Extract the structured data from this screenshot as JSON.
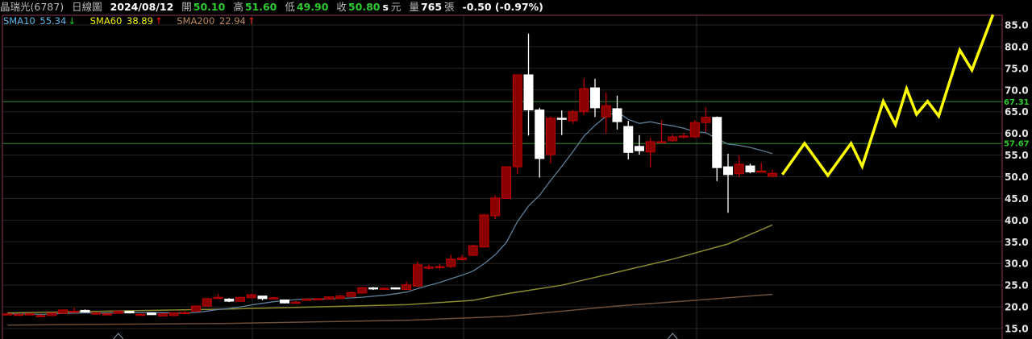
{
  "header": {
    "stock_name": "晶瑞光(6787)",
    "chart_type": "日線圖",
    "date": "2024/08/12",
    "open_label": "開",
    "open": "50.10",
    "high_label": "高",
    "high": "51.60",
    "low_label": "低",
    "low": "49.90",
    "close_label": "收",
    "close": "50.80",
    "unit_s": "s",
    "unit_label": "元",
    "volume_label": "量",
    "volume": "765",
    "volume_unit": "張",
    "change": "-0.50 (-0.97%)"
  },
  "legend": [
    {
      "name": "SMA10",
      "value": "55.34",
      "arrow": "↓",
      "color": "#5fb8e8",
      "arrow_color": "#19d219"
    },
    {
      "name": "SMA60",
      "value": "38.89",
      "arrow": "↑",
      "color": "#f2f200",
      "arrow_color": "#ff2020"
    },
    {
      "name": "SMA200",
      "value": "22.94",
      "arrow": "↑",
      "color": "#b8865a",
      "arrow_color": "#ff2020"
    }
  ],
  "chart_data": {
    "type": "candlestick",
    "ylim": [
      13.5,
      88
    ],
    "y_ticks": [
      "15.0",
      "20.0",
      "25.0",
      "30.0",
      "35.0",
      "40.0",
      "45.0",
      "50.0",
      "55.0",
      "60.0",
      "65.0",
      "70.0",
      "75.0",
      "80.0",
      "85.0"
    ],
    "reference_lines": [
      {
        "value": 67.31,
        "label": "67.31",
        "color": "#2e8b2e"
      },
      {
        "value": 57.67,
        "label": "57.67",
        "color": "#2e8b2e"
      }
    ],
    "colors": {
      "up": "#8b0000",
      "up_border": "#c00000",
      "down": "#ffffff",
      "sma10": "#5f7f96",
      "sma60": "#8a8a30",
      "sma200": "#6b4f3a",
      "forecast": "#ffff00"
    },
    "ohlc": [
      [
        18.4,
        18.6,
        18.2,
        18.4
      ],
      [
        18.3,
        18.5,
        18.1,
        18.3
      ],
      [
        18.4,
        18.6,
        18.2,
        18.4
      ],
      [
        18.0,
        18.3,
        17.8,
        18.0
      ],
      [
        18.0,
        18.7,
        17.9,
        18.6
      ],
      [
        18.5,
        19.4,
        18.4,
        19.3
      ],
      [
        19.0,
        19.8,
        18.8,
        19.0
      ],
      [
        19.2,
        19.4,
        18.7,
        18.8
      ],
      [
        18.6,
        18.8,
        18.4,
        18.6
      ],
      [
        18.4,
        18.6,
        18.2,
        18.4
      ],
      [
        18.5,
        19.2,
        18.4,
        19.0
      ],
      [
        19.0,
        19.1,
        18.5,
        18.6
      ],
      [
        18.3,
        18.5,
        18.1,
        18.3
      ],
      [
        18.6,
        18.7,
        18.1,
        18.2
      ],
      [
        17.9,
        18.5,
        17.8,
        18.4
      ],
      [
        18.0,
        18.7,
        17.9,
        18.6
      ],
      [
        18.7,
        19.0,
        18.5,
        18.7
      ],
      [
        19.0,
        20.3,
        18.9,
        20.2
      ],
      [
        20.2,
        22.0,
        20.1,
        21.9
      ],
      [
        22.2,
        23.0,
        21.9,
        22.2
      ],
      [
        21.8,
        22.0,
        21.1,
        21.3
      ],
      [
        21.3,
        22.3,
        21.2,
        22.2
      ],
      [
        22.1,
        23.0,
        22.0,
        22.8
      ],
      [
        22.5,
        22.6,
        21.5,
        21.9
      ],
      [
        22.1,
        22.3,
        21.9,
        22.1
      ],
      [
        21.6,
        21.7,
        20.8,
        20.9
      ],
      [
        21.1,
        21.3,
        20.8,
        21.1
      ],
      [
        21.5,
        21.9,
        21.4,
        21.8
      ],
      [
        21.6,
        22.0,
        21.5,
        21.9
      ],
      [
        21.8,
        22.4,
        21.7,
        22.3
      ],
      [
        21.9,
        22.8,
        21.8,
        22.5
      ],
      [
        22.4,
        23.6,
        22.3,
        23.3
      ],
      [
        23.2,
        24.6,
        23.0,
        24.4
      ],
      [
        24.4,
        24.6,
        23.9,
        24.3
      ],
      [
        24.2,
        24.5,
        23.9,
        24.3
      ],
      [
        24.4,
        24.5,
        24.0,
        24.3
      ],
      [
        24.0,
        25.8,
        23.9,
        25.1
      ],
      [
        24.8,
        30.4,
        24.6,
        29.7
      ],
      [
        29.2,
        29.8,
        28.6,
        29.2
      ],
      [
        29.2,
        29.9,
        28.7,
        29.3
      ],
      [
        29.3,
        32.0,
        29.0,
        31.0
      ],
      [
        30.9,
        32.0,
        30.6,
        31.3
      ],
      [
        31.9,
        34.4,
        31.7,
        34.1
      ],
      [
        33.8,
        41.4,
        33.7,
        41.2
      ],
      [
        41.0,
        45.7,
        40.3,
        45.1
      ],
      [
        45.0,
        52.3,
        44.9,
        52.3
      ],
      [
        52.3,
        73.5,
        50.6,
        73.5
      ],
      [
        73.5,
        83.0,
        59.5,
        65.4
      ],
      [
        65.4,
        65.9,
        49.8,
        54.2
      ],
      [
        55.1,
        63.9,
        53.0,
        63.5
      ],
      [
        63.5,
        65.3,
        59.6,
        63.3
      ],
      [
        62.9,
        65.4,
        62.2,
        65.0
      ],
      [
        65.0,
        72.7,
        64.2,
        70.3
      ],
      [
        70.5,
        72.6,
        63.8,
        65.9
      ],
      [
        63.8,
        69.4,
        60.0,
        66.4
      ],
      [
        65.7,
        68.7,
        60.9,
        62.7
      ],
      [
        61.6,
        62.9,
        54.0,
        55.6
      ],
      [
        57.0,
        59.6,
        55.1,
        56.0
      ],
      [
        55.7,
        59.0,
        52.1,
        58.1
      ],
      [
        58.1,
        63.1,
        57.9,
        58.1
      ],
      [
        58.3,
        59.8,
        58.1,
        59.2
      ],
      [
        59.4,
        60.1,
        58.8,
        59.4
      ],
      [
        59.2,
        63.1,
        58.9,
        62.5
      ],
      [
        62.5,
        66.0,
        60.3,
        63.7
      ],
      [
        63.7,
        63.9,
        49.0,
        52.1
      ],
      [
        52.3,
        55.3,
        41.7,
        50.5
      ],
      [
        50.7,
        54.9,
        49.9,
        52.9
      ],
      [
        52.5,
        53.0,
        50.8,
        51.1
      ],
      [
        51.2,
        53.2,
        51.0,
        51.3
      ],
      [
        50.1,
        51.6,
        49.9,
        50.8
      ]
    ],
    "sma60": [
      [
        0,
        18.6
      ],
      [
        20,
        19.5
      ],
      [
        36,
        20.5
      ],
      [
        42,
        21.5
      ],
      [
        45,
        23.0
      ],
      [
        50,
        25.0
      ],
      [
        55,
        28.0
      ],
      [
        60,
        31.0
      ],
      [
        65,
        34.5
      ],
      [
        69,
        38.9
      ]
    ],
    "sma200": [
      [
        0,
        15.8
      ],
      [
        20,
        16.2
      ],
      [
        36,
        16.9
      ],
      [
        45,
        17.8
      ],
      [
        55,
        20.2
      ],
      [
        62,
        21.5
      ],
      [
        69,
        22.9
      ]
    ],
    "forecast": [
      [
        69.9,
        50.5
      ],
      [
        71.9,
        57.7
      ],
      [
        74.0,
        50.3
      ],
      [
        76.1,
        57.7
      ],
      [
        77.1,
        52.4
      ],
      [
        79.0,
        67.4
      ],
      [
        80.1,
        62.0
      ],
      [
        81.1,
        70.3
      ],
      [
        82.0,
        64.4
      ],
      [
        83.0,
        67.4
      ],
      [
        84.0,
        64.0
      ],
      [
        85.9,
        79.2
      ],
      [
        87.0,
        74.6
      ],
      [
        88.9,
        87.4
      ]
    ],
    "markers": [
      10,
      60
    ]
  }
}
